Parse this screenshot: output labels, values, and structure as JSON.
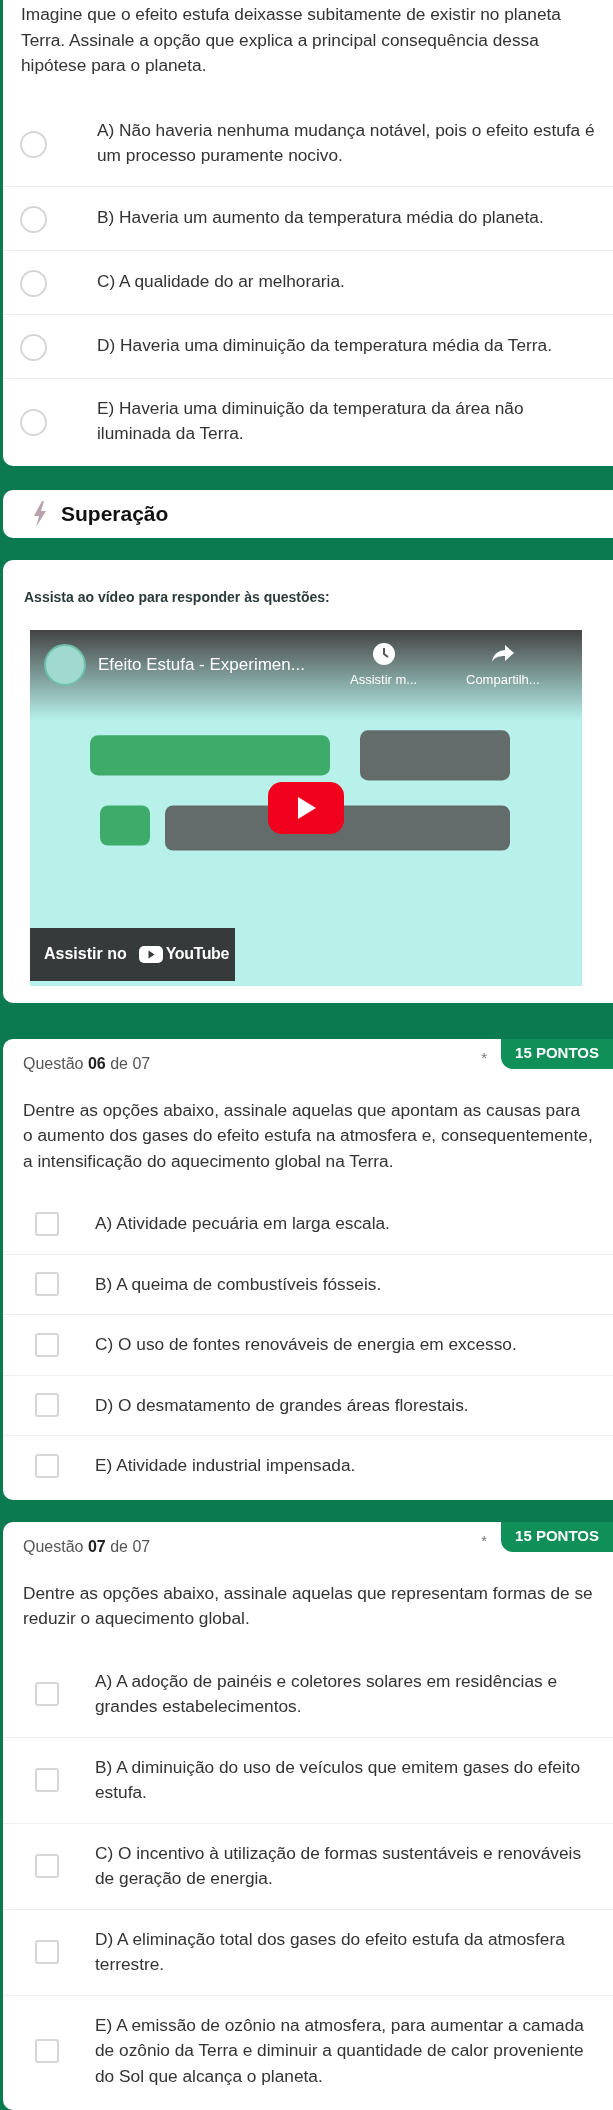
{
  "top_question": {
    "text": "Imagine que o efeito estufa deixasse subitamente de existir no planeta Terra. Assinale a opção que explica a principal consequência dessa hipótese para o planeta.",
    "options": [
      {
        "label": "A) Não haveria nenhuma mudança notável, pois o efeito estufa é um processo puramente nocivo.",
        "selected": false
      },
      {
        "label": "B) Haveria um aumento da temperatura média do planeta.",
        "selected": false
      },
      {
        "label": "C) A qualidade do ar melhoraria.",
        "selected": false
      },
      {
        "label": "D) Haveria uma diminuição da temperatura média da Terra.",
        "selected": false
      },
      {
        "label": "E) Haveria uma diminuição da temperatura da área não iluminada da Terra.",
        "selected": false
      }
    ]
  },
  "section": {
    "title": "Superação"
  },
  "video_card": {
    "instruction": "Assista ao vídeo para responder às questões:",
    "video": {
      "title": "Efeito Estufa - Experimen...",
      "watch_later": "Assistir m...",
      "share": "Compartilh...",
      "watch_on": "Assistir no",
      "brand": "YouTube"
    }
  },
  "questions": [
    {
      "prefix": "Questão",
      "number": "06",
      "suffix": "de 07",
      "required_mark": "*",
      "points": "15 PONTOS",
      "text": "Dentre as opções abaixo, assinale aquelas que apontam as causas para o aumento dos gases do efeito estufa na atmosfera e, consequentemente, a intensificação do aquecimento global na Terra.",
      "options": [
        {
          "label": "A) Atividade pecuária em larga escala.",
          "checked": false
        },
        {
          "label": "B) A queima de combustíveis fósseis.",
          "checked": false
        },
        {
          "label": "C) O uso de fontes renováveis de energia em excesso.",
          "checked": false
        },
        {
          "label": "D) O desmatamento de grandes áreas florestais.",
          "checked": false
        },
        {
          "label": "E) Atividade industrial impensada.",
          "checked": false
        }
      ]
    },
    {
      "prefix": "Questão",
      "number": "07",
      "suffix": "de 07",
      "required_mark": "*",
      "points": "15 PONTOS",
      "text": "Dentre as opções abaixo, assinale aquelas que representam formas de se reduzir o aquecimento global.",
      "options": [
        {
          "label": "A) A adoção de painéis e coletores solares em residências e grandes estabelecimentos.",
          "checked": false
        },
        {
          "label": "B) A diminuição do uso de veículos que emitem gases do efeito estufa.",
          "checked": false
        },
        {
          "label": "C) O incentivo à utilização de formas sustentáveis e renováveis de geração de energia.",
          "checked": false
        },
        {
          "label": "D) A eliminação total dos gases do efeito estufa da atmosfera terrestre.",
          "checked": false
        },
        {
          "label": "E) A emissão de ozônio na atmosfera, para aumentar a camada de ozônio da Terra e diminuir a quantidade de calor proveniente do Sol que alcança o planeta.",
          "checked": false
        }
      ]
    }
  ]
}
